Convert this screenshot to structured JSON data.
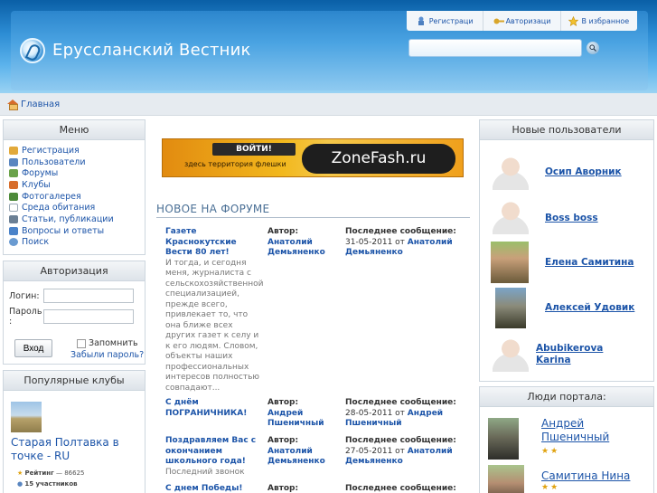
{
  "site": {
    "title": "Еруссланский Вестник"
  },
  "toplinks": [
    {
      "label": "Регистраци",
      "icon": "person-lock-icon"
    },
    {
      "label": "Авторизаци",
      "icon": "key-icon"
    },
    {
      "label": "В избранное",
      "icon": "star-icon"
    }
  ],
  "search": {
    "button_icon": "search-icon"
  },
  "breadcrumb": {
    "home": "Главная"
  },
  "menu": {
    "title": "Меню",
    "items": [
      {
        "label": "Регистрация",
        "icon": "tag-icon",
        "color": "#e2a93a"
      },
      {
        "label": "Пользователи",
        "icon": "users-icon",
        "color": "#5a86c0"
      },
      {
        "label": "Форумы",
        "icon": "forums-icon",
        "color": "#6aa24a"
      },
      {
        "label": "Клубы",
        "icon": "clubs-icon",
        "color": "#d76d2b"
      },
      {
        "label": "Фотогалерея",
        "icon": "photo-icon",
        "color": "#4d8a3a"
      },
      {
        "label": "Среда обитания",
        "icon": "plus-icon",
        "color": "#9aa8b5"
      },
      {
        "label": "Статьи, публикации",
        "icon": "articles-icon",
        "color": "#6b7f94"
      },
      {
        "label": "Вопросы и ответы",
        "icon": "qa-icon",
        "color": "#4a82c8"
      },
      {
        "label": "Поиск",
        "icon": "search-icon",
        "color": "#6a9bd1"
      }
    ]
  },
  "auth": {
    "title": "Авторизация",
    "login_label": "Логин:",
    "password_label": "Пароль :",
    "login_button": "Вход",
    "remember": "Запомнить",
    "forgot": "Забыли пароль?"
  },
  "clubs": {
    "title": "Популярные клубы",
    "club_name": "Старая Полтавка в точке - RU",
    "rating_label": "Рейтинг",
    "rating_value": "— 86625",
    "members": "15 участников"
  },
  "banner": {
    "button": "ВОЙТИ!",
    "tagline": "здесь территория флешки",
    "brand": "ZoneFash.ru"
  },
  "forum": {
    "title": "НОВОЕ НА ФОРУМЕ",
    "topics": [
      {
        "title": "Газете Краснокутские Вести 80 лет!",
        "desc": "И тогда, и сегодня меня, журналиста с сельскохозяйственной специализацией, прежде всего, привлекает то, что она ближе всех других газет к селу и к его людям. Словом, объекты наших профессиональных интересов полностью совпадают...",
        "author_label": "Автор:",
        "author": "Анатолий Демьяненко",
        "last_label": "Последнее сообщение:",
        "last_date": "31-05-2011 от",
        "last_author": "Анатолий Демьяненко"
      },
      {
        "title": "С днём ПОГРАНИЧНИКА!",
        "desc": "",
        "author_label": "Автор:",
        "author": "Андрей Пшеничный",
        "last_label": "Последнее сообщение:",
        "last_date": "28-05-2011 от",
        "last_author": "Андрей Пшеничный"
      },
      {
        "title": "Поздравляем Вас с окончанием школьного года!",
        "desc": "Последний звонок",
        "author_label": "Автор:",
        "author": "Анатолий Демьяненко",
        "last_label": "Последнее сообщение:",
        "last_date": "27-05-2011 от",
        "last_author": "Анатолий Демьяненко"
      },
      {
        "title": "С днем Победы!",
        "desc": "",
        "author_label": "Автор:",
        "author": "",
        "last_label": "Последнее сообщение:",
        "last_date": "",
        "last_author": ""
      }
    ]
  },
  "new_users": {
    "title": "Новые пользователи",
    "users": [
      {
        "name": "Осип Аворник"
      },
      {
        "name": "Boss boss"
      },
      {
        "name": "Елена Самитина"
      },
      {
        "name": "Алексей Удовик"
      },
      {
        "name": "Abubikerova Karina"
      }
    ]
  },
  "portal_people": {
    "title": "Люди портала:",
    "people": [
      {
        "name": "Андрей Пшеничный"
      },
      {
        "name": "Самитина Нина"
      }
    ]
  }
}
